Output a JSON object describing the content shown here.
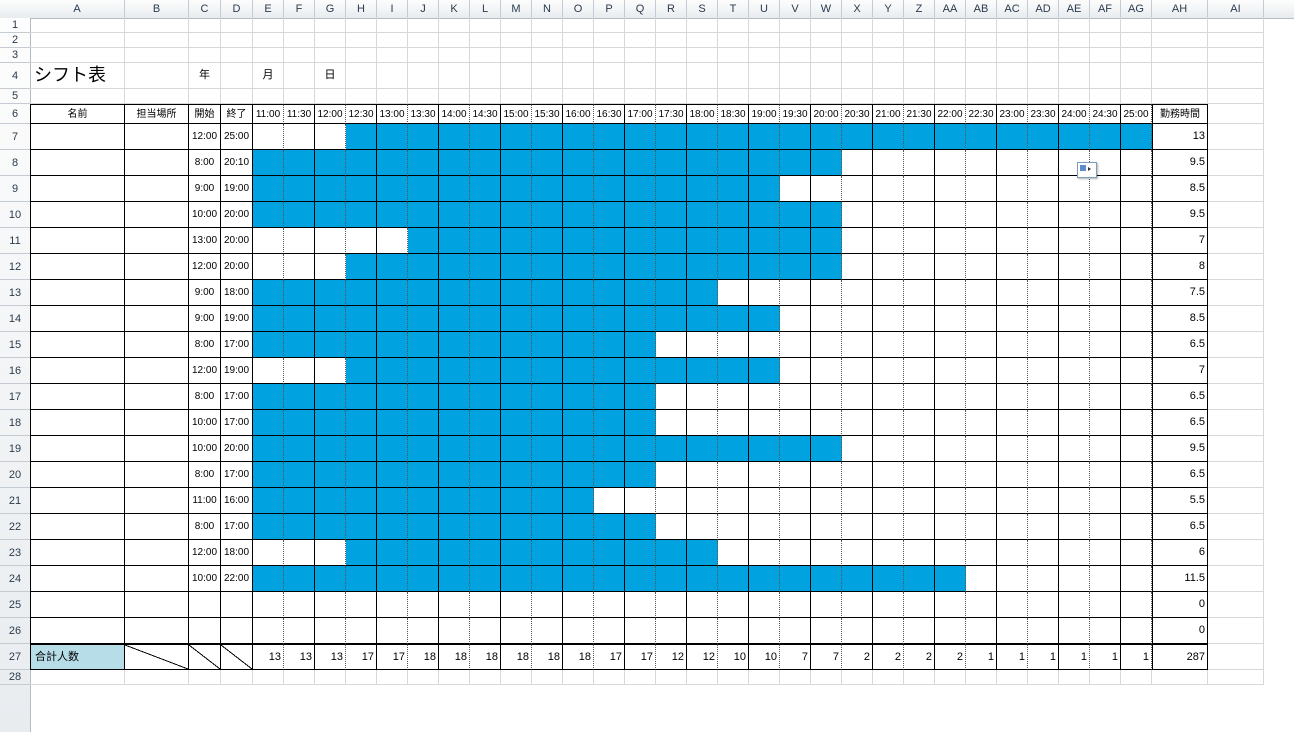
{
  "columns": [
    "A",
    "B",
    "C",
    "D",
    "E",
    "F",
    "G",
    "H",
    "I",
    "J",
    "K",
    "L",
    "M",
    "N",
    "O",
    "P",
    "Q",
    "R",
    "S",
    "T",
    "U",
    "V",
    "W",
    "X",
    "Y",
    "Z",
    "AA",
    "AB",
    "AC",
    "AD",
    "AE",
    "AF",
    "AG",
    "AH",
    "AI"
  ],
  "rowCount": 28,
  "title": "シフト表",
  "dateLabels": {
    "year": "年",
    "month": "月",
    "day": "日"
  },
  "headers": {
    "name": "名前",
    "place": "担当場所",
    "start": "開始",
    "end": "終了",
    "work": "勤務時間",
    "times": [
      "11:00",
      "11:30",
      "12:00",
      "12:30",
      "13:00",
      "13:30",
      "14:00",
      "14:30",
      "15:00",
      "15:30",
      "16:00",
      "16:30",
      "17:00",
      "17:30",
      "18:00",
      "18:30",
      "19:00",
      "19:30",
      "20:00",
      "20:30",
      "21:00",
      "21:30",
      "22:00",
      "22:30",
      "23:00",
      "23:30",
      "24:00",
      "24:30",
      "25:00"
    ]
  },
  "shifts": [
    {
      "start": "12:00",
      "end": "25:00",
      "hours": 13,
      "slots": [
        0,
        0,
        0,
        1,
        1,
        1,
        1,
        1,
        1,
        1,
        1,
        1,
        1,
        1,
        1,
        1,
        1,
        1,
        1,
        1,
        1,
        1,
        1,
        1,
        1,
        1,
        1,
        1,
        1
      ]
    },
    {
      "start": "8:00",
      "end": "20:10",
      "hours": 9.5,
      "slots": [
        1,
        1,
        1,
        1,
        1,
        1,
        1,
        1,
        1,
        1,
        1,
        1,
        1,
        1,
        1,
        1,
        1,
        1,
        1,
        0,
        0,
        0,
        0,
        0,
        0,
        0,
        0,
        0,
        0
      ]
    },
    {
      "start": "9:00",
      "end": "19:00",
      "hours": 8.5,
      "slots": [
        1,
        1,
        1,
        1,
        1,
        1,
        1,
        1,
        1,
        1,
        1,
        1,
        1,
        1,
        1,
        1,
        1,
        0,
        0,
        0,
        0,
        0,
        0,
        0,
        0,
        0,
        0,
        0,
        0
      ]
    },
    {
      "start": "10:00",
      "end": "20:00",
      "hours": 9.5,
      "slots": [
        1,
        1,
        1,
        1,
        1,
        1,
        1,
        1,
        1,
        1,
        1,
        1,
        1,
        1,
        1,
        1,
        1,
        1,
        1,
        0,
        0,
        0,
        0,
        0,
        0,
        0,
        0,
        0,
        0
      ]
    },
    {
      "start": "13:00",
      "end": "20:00",
      "hours": 7,
      "slots": [
        0,
        0,
        0,
        0,
        0,
        1,
        1,
        1,
        1,
        1,
        1,
        1,
        1,
        1,
        1,
        1,
        1,
        1,
        1,
        0,
        0,
        0,
        0,
        0,
        0,
        0,
        0,
        0,
        0
      ]
    },
    {
      "start": "12:00",
      "end": "20:00",
      "hours": 8,
      "slots": [
        0,
        0,
        0,
        1,
        1,
        1,
        1,
        1,
        1,
        1,
        1,
        1,
        1,
        1,
        1,
        1,
        1,
        1,
        1,
        0,
        0,
        0,
        0,
        0,
        0,
        0,
        0,
        0,
        0
      ]
    },
    {
      "start": "9:00",
      "end": "18:00",
      "hours": 7.5,
      "slots": [
        1,
        1,
        1,
        1,
        1,
        1,
        1,
        1,
        1,
        1,
        1,
        1,
        1,
        1,
        1,
        0,
        0,
        0,
        0,
        0,
        0,
        0,
        0,
        0,
        0,
        0,
        0,
        0,
        0
      ]
    },
    {
      "start": "9:00",
      "end": "19:00",
      "hours": 8.5,
      "slots": [
        1,
        1,
        1,
        1,
        1,
        1,
        1,
        1,
        1,
        1,
        1,
        1,
        1,
        1,
        1,
        1,
        1,
        0,
        0,
        0,
        0,
        0,
        0,
        0,
        0,
        0,
        0,
        0,
        0
      ]
    },
    {
      "start": "8:00",
      "end": "17:00",
      "hours": 6.5,
      "slots": [
        1,
        1,
        1,
        1,
        1,
        1,
        1,
        1,
        1,
        1,
        1,
        1,
        1,
        0,
        0,
        0,
        0,
        0,
        0,
        0,
        0,
        0,
        0,
        0,
        0,
        0,
        0,
        0,
        0
      ]
    },
    {
      "start": "12:00",
      "end": "19:00",
      "hours": 7,
      "slots": [
        0,
        0,
        0,
        1,
        1,
        1,
        1,
        1,
        1,
        1,
        1,
        1,
        1,
        1,
        1,
        1,
        1,
        0,
        0,
        0,
        0,
        0,
        0,
        0,
        0,
        0,
        0,
        0,
        0
      ]
    },
    {
      "start": "8:00",
      "end": "17:00",
      "hours": 6.5,
      "slots": [
        1,
        1,
        1,
        1,
        1,
        1,
        1,
        1,
        1,
        1,
        1,
        1,
        1,
        0,
        0,
        0,
        0,
        0,
        0,
        0,
        0,
        0,
        0,
        0,
        0,
        0,
        0,
        0,
        0
      ]
    },
    {
      "start": "10:00",
      "end": "17:00",
      "hours": 6.5,
      "slots": [
        1,
        1,
        1,
        1,
        1,
        1,
        1,
        1,
        1,
        1,
        1,
        1,
        1,
        0,
        0,
        0,
        0,
        0,
        0,
        0,
        0,
        0,
        0,
        0,
        0,
        0,
        0,
        0,
        0
      ]
    },
    {
      "start": "10:00",
      "end": "20:00",
      "hours": 9.5,
      "slots": [
        1,
        1,
        1,
        1,
        1,
        1,
        1,
        1,
        1,
        1,
        1,
        1,
        1,
        1,
        1,
        1,
        1,
        1,
        1,
        0,
        0,
        0,
        0,
        0,
        0,
        0,
        0,
        0,
        0
      ]
    },
    {
      "start": "8:00",
      "end": "17:00",
      "hours": 6.5,
      "slots": [
        1,
        1,
        1,
        1,
        1,
        1,
        1,
        1,
        1,
        1,
        1,
        1,
        1,
        0,
        0,
        0,
        0,
        0,
        0,
        0,
        0,
        0,
        0,
        0,
        0,
        0,
        0,
        0,
        0
      ]
    },
    {
      "start": "11:00",
      "end": "16:00",
      "hours": 5.5,
      "slots": [
        1,
        1,
        1,
        1,
        1,
        1,
        1,
        1,
        1,
        1,
        1,
        0,
        0,
        0,
        0,
        0,
        0,
        0,
        0,
        0,
        0,
        0,
        0,
        0,
        0,
        0,
        0,
        0,
        0
      ]
    },
    {
      "start": "8:00",
      "end": "17:00",
      "hours": 6.5,
      "slots": [
        1,
        1,
        1,
        1,
        1,
        1,
        1,
        1,
        1,
        1,
        1,
        1,
        1,
        0,
        0,
        0,
        0,
        0,
        0,
        0,
        0,
        0,
        0,
        0,
        0,
        0,
        0,
        0,
        0
      ]
    },
    {
      "start": "12:00",
      "end": "18:00",
      "hours": 6,
      "slots": [
        0,
        0,
        0,
        1,
        1,
        1,
        1,
        1,
        1,
        1,
        1,
        1,
        1,
        1,
        1,
        0,
        0,
        0,
        0,
        0,
        0,
        0,
        0,
        0,
        0,
        0,
        0,
        0,
        0
      ]
    },
    {
      "start": "10:00",
      "end": "22:00",
      "hours": 11.5,
      "slots": [
        1,
        1,
        1,
        1,
        1,
        1,
        1,
        1,
        1,
        1,
        1,
        1,
        1,
        1,
        1,
        1,
        1,
        1,
        1,
        1,
        1,
        1,
        1,
        0,
        0,
        0,
        0,
        0,
        0
      ]
    },
    {
      "start": "",
      "end": "",
      "hours": 0,
      "slots": [
        0,
        0,
        0,
        0,
        0,
        0,
        0,
        0,
        0,
        0,
        0,
        0,
        0,
        0,
        0,
        0,
        0,
        0,
        0,
        0,
        0,
        0,
        0,
        0,
        0,
        0,
        0,
        0,
        0
      ]
    },
    {
      "start": "",
      "end": "",
      "hours": 0,
      "slots": [
        0,
        0,
        0,
        0,
        0,
        0,
        0,
        0,
        0,
        0,
        0,
        0,
        0,
        0,
        0,
        0,
        0,
        0,
        0,
        0,
        0,
        0,
        0,
        0,
        0,
        0,
        0,
        0,
        0
      ]
    }
  ],
  "totals": {
    "label": "合計人数",
    "values": [
      13,
      13,
      13,
      17,
      17,
      18,
      18,
      18,
      18,
      18,
      18,
      17,
      17,
      12,
      12,
      10,
      10,
      7,
      7,
      2,
      2,
      2,
      2,
      1,
      1,
      1,
      1,
      1,
      1
    ],
    "grand": 287
  }
}
